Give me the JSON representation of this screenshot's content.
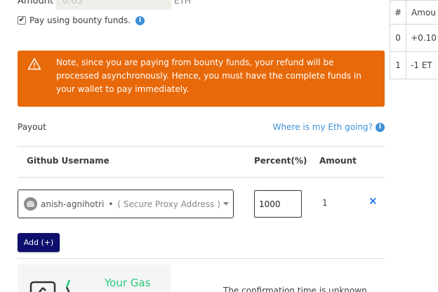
{
  "amount": {
    "label": "Amount",
    "value": "0.03",
    "unit": "ETH"
  },
  "bounty_funds": {
    "label": "Pay using bounty funds.",
    "checked": true
  },
  "alert": {
    "text": "Note, since you are paying from bounty funds, your refund will be processed asynchronously. Hence, you must have the complete funds in your wallet to pay immediately."
  },
  "payout": {
    "label": "Payout",
    "eth_link": "Where is my Eth going?"
  },
  "table": {
    "headers": {
      "username": "Github Username",
      "percent": "Percent(%)",
      "amount": "Amount"
    },
    "row": {
      "username": "anish-agnihotri",
      "separator": "•",
      "address": "( Secure Proxy Address )",
      "percent": "1000",
      "amount": "1",
      "remove": "×"
    }
  },
  "add_button": "Add (+)",
  "gas": {
    "title": "Your Gas"
  },
  "confirm_text": "The confirmation time is unknown",
  "side_table": {
    "headers": [
      "#",
      "Amou"
    ],
    "rows": [
      [
        "0",
        "+0.10"
      ],
      [
        "1",
        "-1 ET"
      ]
    ]
  },
  "colors": {
    "alert": "#e8690a",
    "link": "#3e8fd6",
    "button": "#0e0e6e",
    "gas_title": "#25c97a",
    "remove": "#1a73e8"
  }
}
